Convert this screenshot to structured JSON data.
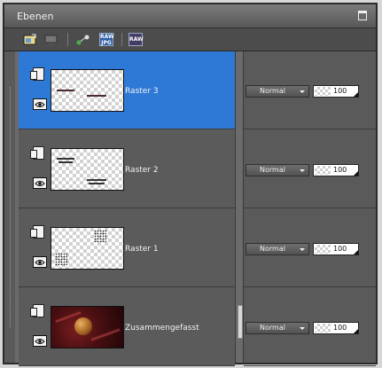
{
  "window": {
    "title": "Ebenen"
  },
  "toolbar": {
    "raw_jpg_top": "RAW",
    "raw_jpg_bottom": "JPG",
    "raw_label": "RAW"
  },
  "layers": [
    {
      "name": "Raster 3",
      "blend_mode": "Normal",
      "opacity": "100",
      "selected": true
    },
    {
      "name": "Raster 2",
      "blend_mode": "Normal",
      "opacity": "100",
      "selected": false
    },
    {
      "name": "Raster 1",
      "blend_mode": "Normal",
      "opacity": "100",
      "selected": false
    },
    {
      "name": "Zusammengefasst",
      "blend_mode": "Normal",
      "opacity": "100",
      "selected": false
    }
  ],
  "colors": {
    "selected_row": "#2f79d6",
    "panel_bg": "#5a5a5a"
  }
}
